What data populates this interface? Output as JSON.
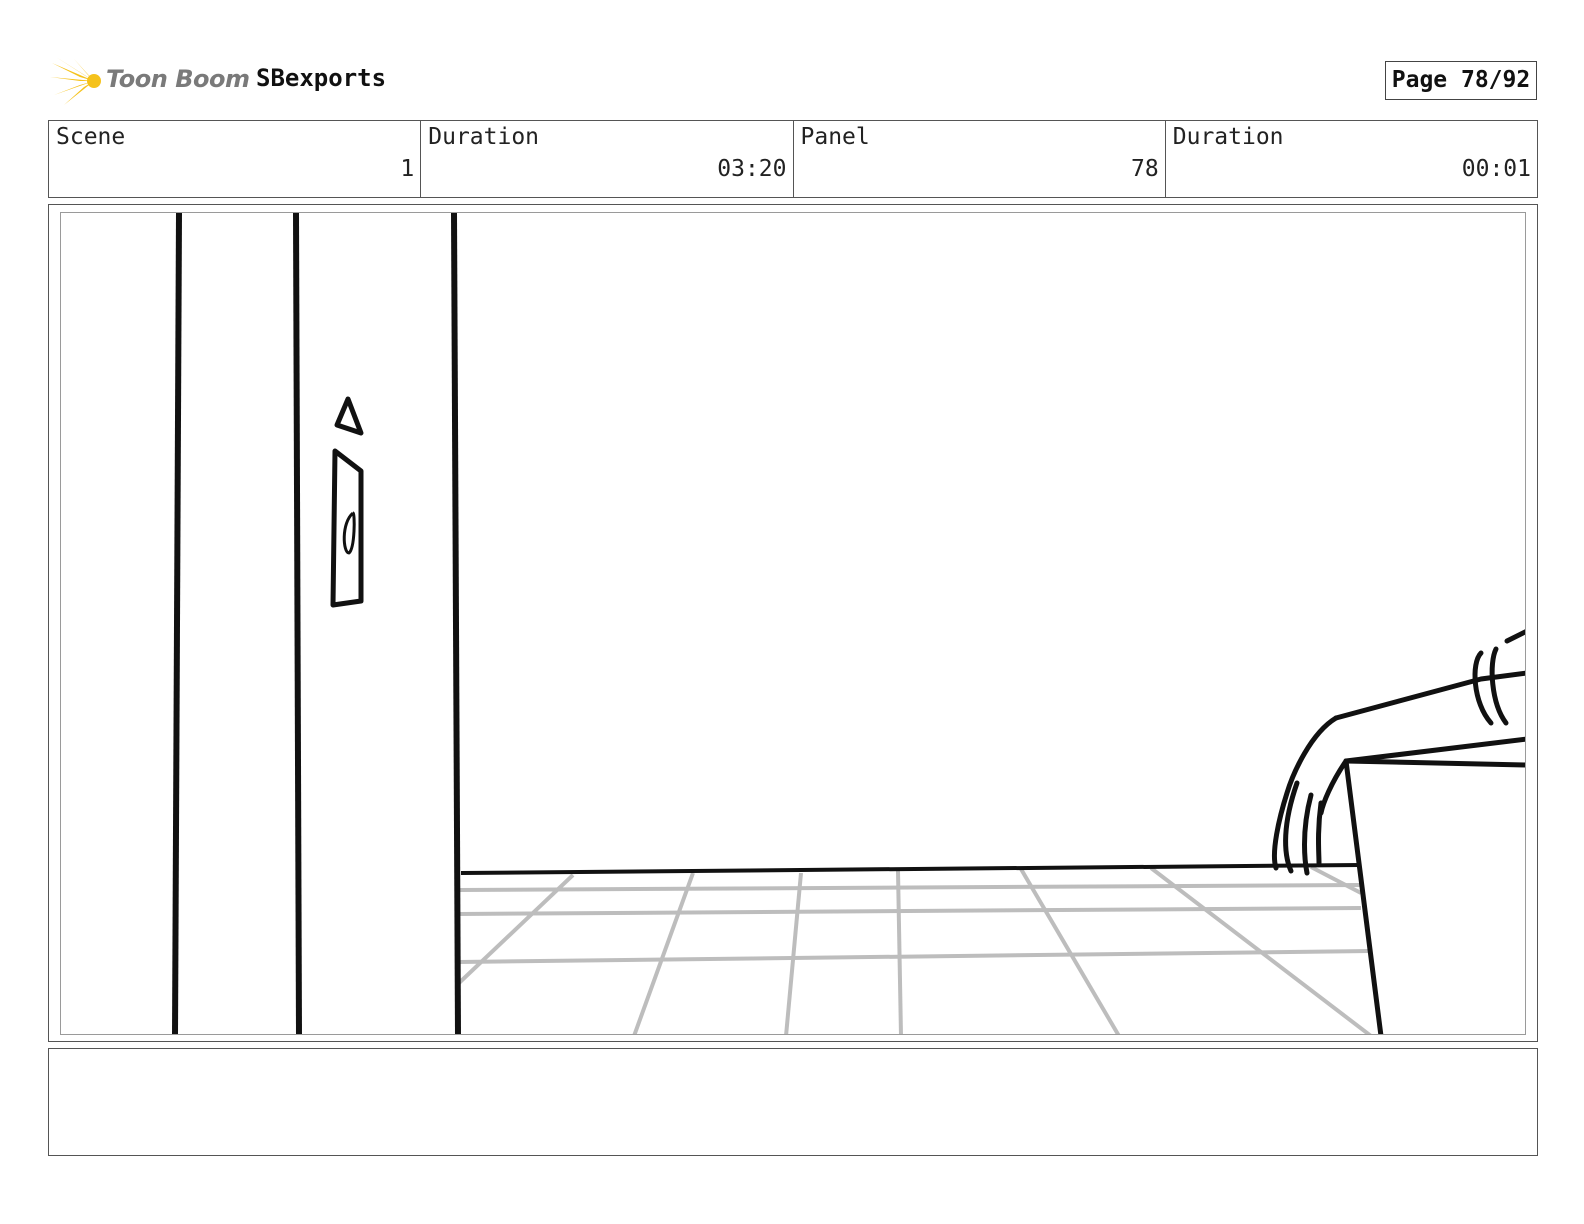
{
  "header": {
    "brand": "Toon Boom",
    "project": "SBexports",
    "page": "Page 78/92"
  },
  "info": {
    "scene_label": "Scene",
    "scene_value": "1",
    "scene_duration_label": "Duration",
    "scene_duration_value": "03:20",
    "panel_label": "Panel",
    "panel_value": "78",
    "panel_duration_label": "Duration",
    "panel_duration_value": "00:01"
  },
  "notes": {
    "text": ""
  }
}
